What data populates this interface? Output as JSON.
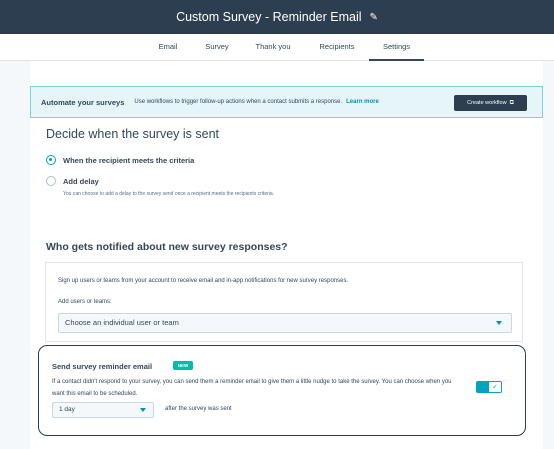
{
  "header": {
    "title": "Custom Survey - Reminder Email",
    "edit_icon": "pencil-icon"
  },
  "tabs": [
    {
      "label": "Email",
      "active": false
    },
    {
      "label": "Survey",
      "active": false
    },
    {
      "label": "Thank you",
      "active": false
    },
    {
      "label": "Recipients",
      "active": false
    },
    {
      "label": "Settings",
      "active": true
    }
  ],
  "banner": {
    "title": "Automate your surveys",
    "description": "Use workflows to trigger follow-up actions when a contact submits a response.",
    "link": "Learn more",
    "button": "Create workflow",
    "button_icon": "external-link-icon"
  },
  "send_section": {
    "heading": "Decide when the survey is sent",
    "options": [
      {
        "label": "When the recipient meets the criteria",
        "selected": true
      },
      {
        "label": "Add delay",
        "selected": false,
        "help": "You can choose to add a delay to the survey send once a recipient meets the recipients criteria."
      }
    ]
  },
  "notify_section": {
    "heading": "Who gets notified about new survey responses?",
    "description": "Sign up users or teams from your account to receive email and in-app notifications for new survey responses.",
    "field_label": "Add users or teams:",
    "select_value": "Choose an individual user or team"
  },
  "reminder": {
    "title": "Send survey reminder email",
    "badge": "NEW",
    "description": "If a contact didn't respond to your survey, you can send them a reminder email to give them a little nudge to take the survey. You can choose when you want this email to be scheduled.",
    "delay_value": "1 day",
    "delay_suffix": "after the survey was sent",
    "enabled": true
  },
  "colors": {
    "header_bg": "#2d3e50",
    "accent": "#00a4bd",
    "banner_bg": "#e5f5f8",
    "badge": "#00bda5"
  }
}
